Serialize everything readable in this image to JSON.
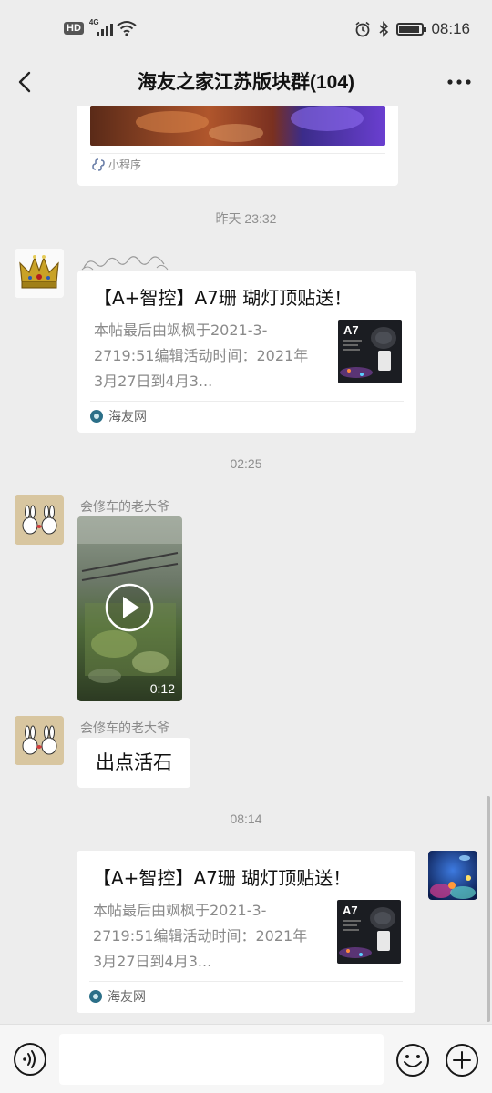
{
  "status_bar": {
    "hd": "HD",
    "network": "4G",
    "time": "08:16"
  },
  "nav": {
    "title": "海友之家江苏版块群(104)"
  },
  "mini_program": {
    "label": "小程序"
  },
  "timestamps": {
    "t1": "昨天 23:32",
    "t2": "02:25",
    "t3": "08:14"
  },
  "link_card": {
    "title": "【A+智控】A7珊 瑚灯顶贴送！",
    "description": "本帖最后由飒枫于2021-3-2719:51编辑活动时间：2021年3月27日到4月3...",
    "source": "海友网",
    "thumb_label": "A7"
  },
  "video_message": {
    "sender": "会修车的老大爷",
    "duration": "0:12"
  },
  "text_message": {
    "sender": "会修车的老大爷",
    "text": "出点活石"
  }
}
